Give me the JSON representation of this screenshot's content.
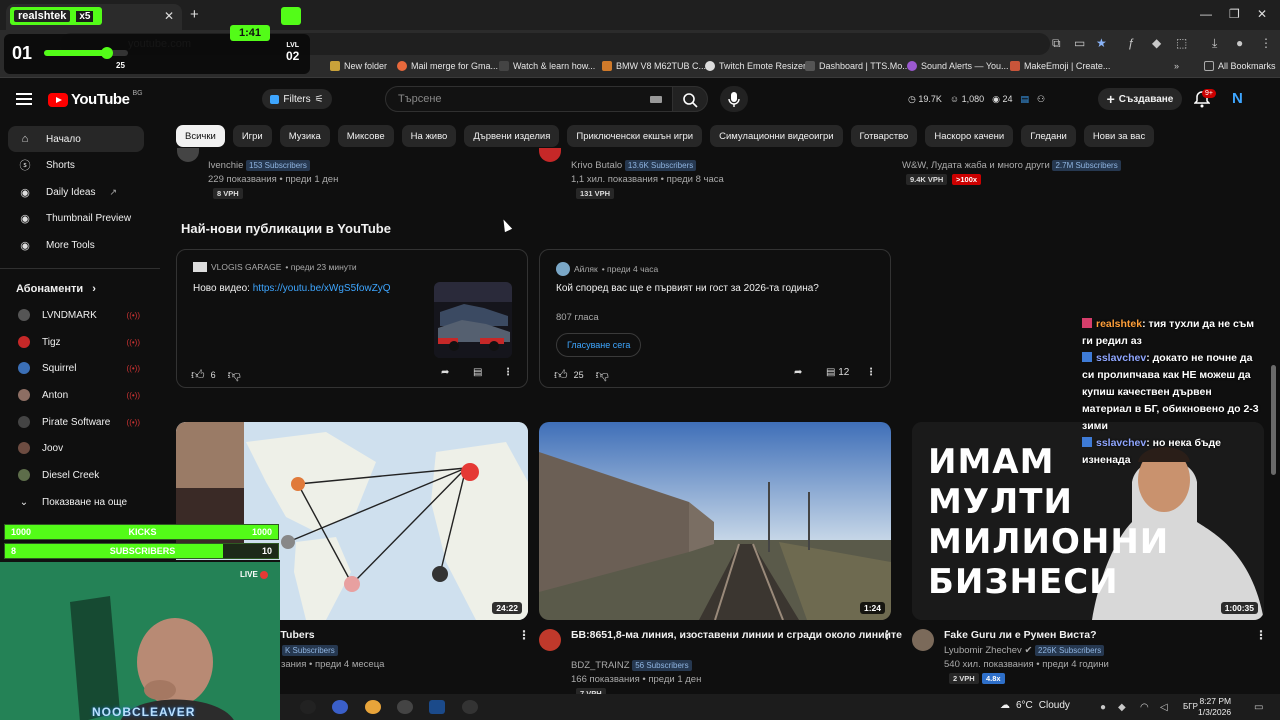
{
  "browser": {
    "url": "youtube.com",
    "bookmarks": [
      "New folder",
      "Mail merge for Gma...",
      "Watch & learn how...",
      "BMW V8 M62TUB C...",
      "Twitch Emote Resizer",
      "Dashboard | TTS.Mo...",
      "Sound Alerts — You...",
      "MakeEmoji | Create...",
      "All Bookmarks"
    ]
  },
  "header": {
    "logo_text": "YouTube",
    "country_code": "BG",
    "filters_label": "Filters",
    "search_placeholder": "Търсене",
    "stat1": "19.7K",
    "stat2": "1,080",
    "stat3": "24",
    "create_label": "Създаване",
    "notif_count": "9+",
    "avatar_letter": "N"
  },
  "sidebar": {
    "items": [
      {
        "label": "Начало",
        "icon": "home-icon"
      },
      {
        "label": "Shorts",
        "icon": "shorts-icon"
      },
      {
        "label": "Daily Ideas",
        "icon": "ideas-icon"
      },
      {
        "label": "Thumbnail Preview",
        "icon": "thumbnail-icon"
      },
      {
        "label": "More Tools",
        "icon": "tools-icon"
      }
    ],
    "subs_heading": "Абонаменти",
    "subs": [
      {
        "label": "LVNDMARK",
        "live": true
      },
      {
        "label": "Tigz",
        "live": true
      },
      {
        "label": "Squirrel",
        "live": true
      },
      {
        "label": "Anton",
        "live": true
      },
      {
        "label": "Pirate Software",
        "live": true
      },
      {
        "label": "Joov",
        "live": false
      },
      {
        "label": "Diesel Creek",
        "live": false
      }
    ],
    "show_more": "Показване на още"
  },
  "chips": [
    "Всички",
    "Игри",
    "Музика",
    "Миксове",
    "На живо",
    "Дървени изделия",
    "Приключенски екшън игри",
    "Симулационни видеоигри",
    "Готварство",
    "Наскоро качени",
    "Гледани",
    "Нови за вас"
  ],
  "top_row": [
    {
      "channel": "Ivenchie",
      "subs": "153 Subscribers",
      "meta": "229 показвания • преди 1 ден",
      "vph": "8 VPH"
    },
    {
      "channel": "Krivo Butalo",
      "subs": "13.6K Subscribers",
      "meta": "1,1 хил. показвания • преди 8 часа",
      "vph": "131 VPH"
    },
    {
      "channel": "W&W, Лудата жаба и много други",
      "subs": "2.7M Subscribers",
      "vph": "9.4K VPH",
      "badge": ">100x"
    }
  ],
  "posts_section": {
    "title": "Най-нови публикации в YouTube",
    "post1": {
      "channel": "VLOGIS GARAGE",
      "time": "• преди 23 минути",
      "text": "Ново видео: ",
      "link": "https://youtu.be/xWgS5fowZyQ",
      "likes": "6"
    },
    "post2": {
      "channel": "Айляк",
      "time": "• преди 4 часа",
      "text": "Кой според вас ще е първият ни гост за 2026-та година?",
      "votes": "807 гласа",
      "vote_button": "Гласуване сега",
      "likes": "25",
      "comments": "12"
    }
  },
  "videos": [
    {
      "title": "uTubers",
      "meta": "зания • преди 4 месеца",
      "duration": "24:22",
      "subs_partial": "K Subscribers"
    },
    {
      "title": "БВ:8651,8-ма линия, изоставени линии и сгради около линиите",
      "channel": "BDZ_TRAINZ",
      "subs": "56 Subscribers",
      "meta": "166 показвания • преди 1 ден",
      "vph": "7 VPH",
      "duration": "1:24"
    },
    {
      "title": "Fake Guru ли е Румен Виста?",
      "channel": "Lyubomir Zhechev",
      "subs": "226K Subscribers",
      "meta": "540 хил. показвания • преди 4 години",
      "vph": "2 VPH",
      "badge": "4.8x",
      "duration": "1:00:35",
      "thumb_text": [
        "ИМАМ",
        "МУЛТИ",
        "МИЛИОННИ",
        "БИЗНЕСИ"
      ]
    }
  ],
  "stream": {
    "username": "realshtek",
    "multiplier": "x5",
    "level_left": "01",
    "level_right": "02",
    "level_label": "LVL",
    "progress_value": "25",
    "progress_fraction": 0.25,
    "timer": "1:41",
    "kicks_left": "1000",
    "kicks_label": "KICKS",
    "kicks_right": "1000",
    "kicks_fraction": 1.0,
    "subs_left": "8",
    "subs_label": "SUBSCRIBERS",
    "subs_right": "10",
    "subs_fraction": 0.8,
    "live_label": "LIVE",
    "cam_name": "NOOBCLEAVER"
  },
  "chat": [
    {
      "nick": "realshtek",
      "text": ": тия тухли да не съм ги редил аз"
    },
    {
      "nick": "sslavchev",
      "text": ": докато не почне да си пролипчава как НЕ можеш да купиш качествен дървен материал в БГ, обикновено до 2-3 зими"
    },
    {
      "nick": "sslavchev",
      "text": ": но нека бъде изненада"
    }
  ],
  "taskbar": {
    "weather": "6°C",
    "weather_desc": "Cloudy",
    "lang": "БГР",
    "time": "8:27 PM",
    "date": "1/3/2026"
  }
}
